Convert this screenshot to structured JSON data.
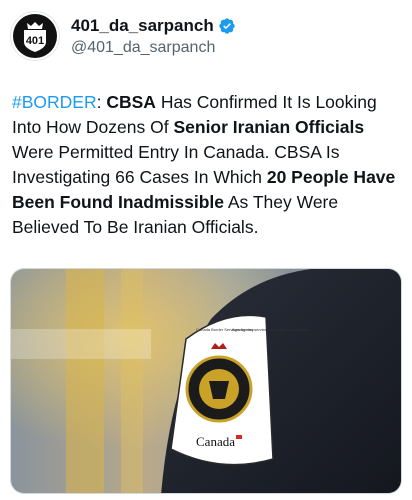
{
  "author": {
    "display_name": "401_da_sarpanch",
    "handle": "@401_da_sarpanch",
    "avatar_text": "401",
    "verified_icon": "verified-badge-icon",
    "colors": {
      "verified": "#1d9bf0",
      "handle": "#536471"
    }
  },
  "tweet": {
    "hashtag": "#BORDER",
    "colon": ":",
    "seg1": "CBSA",
    "seg2": " Has Confirmed It Is Looking Into How Dozens Of ",
    "seg3": "Senior Iranian Officials",
    "seg4": " Were Permitted Entry In Canada. CBSA Is Investigating 66 Cases In Which ",
    "seg5": "20 People Have Been Found Inadmissible",
    "seg6": " As They Were Believed To Be Iranian Officials.",
    "colors": {
      "hashtag": "#1d9bf0",
      "text": "#0f1419"
    }
  },
  "media": {
    "patch_text_en": "Canada Border Services Agency",
    "patch_text_fr": "Agence des services frontaliers du Canada",
    "wordmark": "Canada"
  }
}
